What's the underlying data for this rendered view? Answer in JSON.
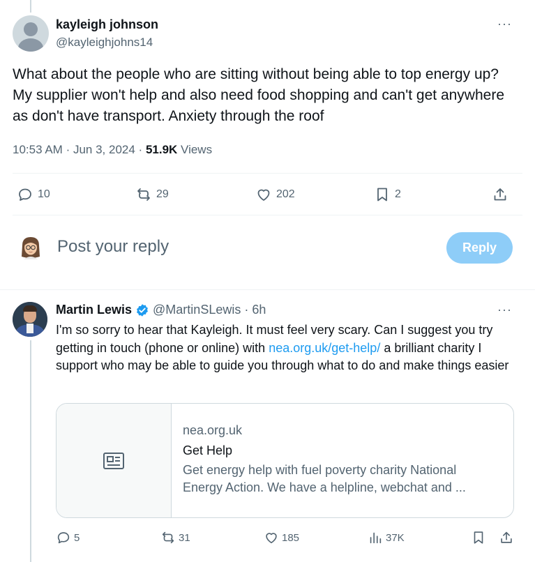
{
  "main_tweet": {
    "author_name": "kayleigh johnson",
    "author_handle": "@kayleighjohns14",
    "more": "···",
    "text": "What about the people who are sitting without being able to top energy up? My supplier won't help and also need food shopping and can't get anywhere as don't have transport. Anxiety through the roof",
    "time": "10:53 AM",
    "date": "Jun 3, 2024",
    "views_count": "51.9K",
    "views_label": "Views",
    "replies": "10",
    "reposts": "29",
    "likes": "202",
    "bookmarks": "2"
  },
  "composer": {
    "placeholder": "Post your reply",
    "button": "Reply",
    "button_color": "#8ecdf8"
  },
  "reply": {
    "author_name": "Martin Lewis",
    "author_handle": "@MartinSLewis",
    "time": "6h",
    "more": "···",
    "text_before": "I'm so sorry to hear that Kayleigh.  It must feel very scary.  Can I suggest you try getting in touch (phone or online) with ",
    "link": "nea.org.uk/get-help/",
    "text_after": " a brilliant charity I support who may be able to guide you through what to do and make things easier",
    "card": {
      "domain": "nea.org.uk",
      "title": "Get Help",
      "description": "Get energy help with fuel poverty charity National Energy Action. We have a helpline, webchat and ..."
    },
    "replies": "5",
    "reposts": "31",
    "likes": "185",
    "views": "37K"
  },
  "colors": {
    "link": "#1d9bf0",
    "secondary_text": "#536471",
    "verified": "#1d9bf0"
  },
  "icons": [
    "reply-icon",
    "repost-icon",
    "like-icon",
    "bookmark-icon",
    "share-icon",
    "verified-badge-icon",
    "views-icon",
    "news-article-icon"
  ]
}
